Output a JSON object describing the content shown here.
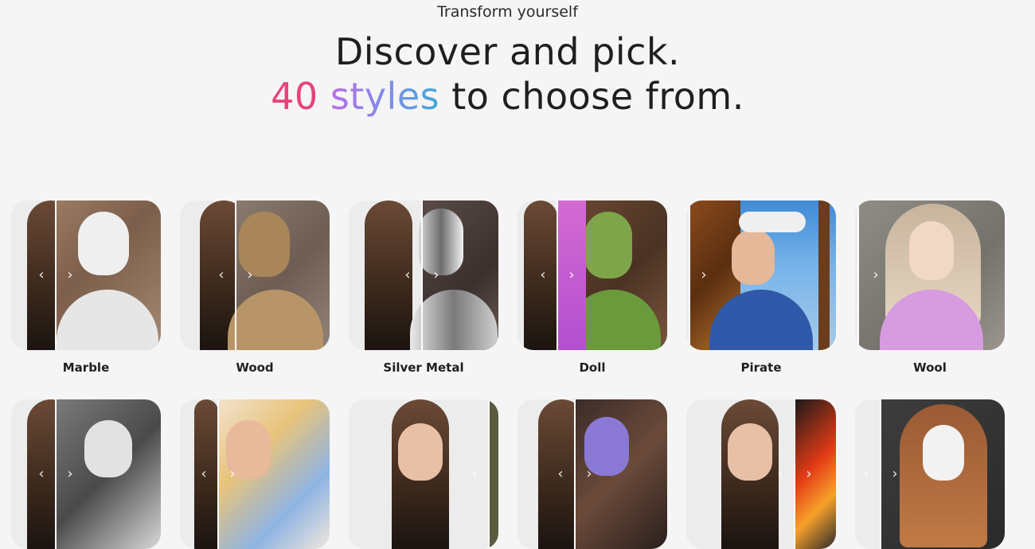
{
  "hero": {
    "eyebrow": "Transform yourself",
    "title_line1": "Discover and pick.",
    "title_line2_num": "40",
    "title_line2_styles": "styles",
    "title_line2_rest": " to choose from."
  },
  "colors": {
    "background": "#f5f5f5",
    "accent_number": "#e8427a",
    "gradient_start": "#b86ee6",
    "gradient_end": "#3fa9d6"
  },
  "styles": [
    {
      "label": "Marble"
    },
    {
      "label": "Wood"
    },
    {
      "label": "Silver Metal"
    },
    {
      "label": "Doll"
    },
    {
      "label": "Pirate"
    },
    {
      "label": "Wool"
    }
  ],
  "second_row": [
    {
      "style": "black-and-white-sketch"
    },
    {
      "style": "watercolor"
    },
    {
      "style": "original"
    },
    {
      "style": "purple-fantasy"
    },
    {
      "style": "fire"
    },
    {
      "style": "skull"
    }
  ],
  "icons": {
    "prev": "chevron-left-icon",
    "next": "chevron-right-icon"
  }
}
